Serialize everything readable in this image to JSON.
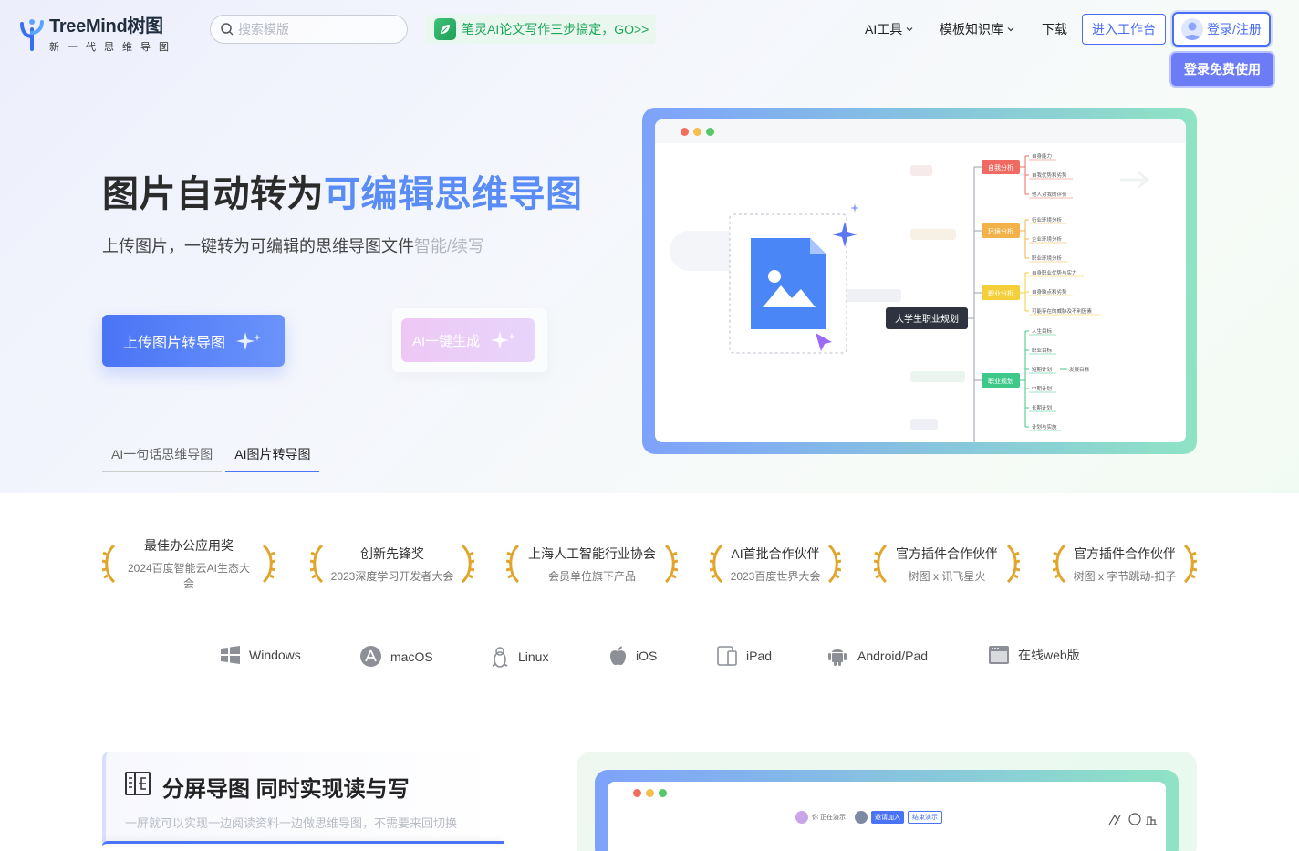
{
  "header": {
    "logo_name": "TreeMind树图",
    "logo_slogan": "新一代思维导图",
    "search_placeholder": "搜索模版",
    "promo_text": "笔灵AI论文写作三步搞定，GO>>",
    "nav": [
      {
        "label": "AI工具",
        "has_dropdown": true
      },
      {
        "label": "模板知识库",
        "has_dropdown": true
      },
      {
        "label": "下载",
        "has_dropdown": false
      }
    ],
    "workspace_label": "进入工作台",
    "login_label": "登录/注册",
    "free_label": "登录免费使用"
  },
  "hero": {
    "title_main": "图片自动转为",
    "title_highlight": "可编辑思维导图",
    "subtitle": "上传图片，一键转为可编辑的思维导图文件",
    "subtitle_fade": "智能/续写",
    "upload_label": "上传图片转导图",
    "ai_label": "AI一键生成",
    "tabs": [
      {
        "label": "AI一句话思维导图",
        "active": false
      },
      {
        "label": "AI图片转导图",
        "active": true
      }
    ]
  },
  "preview": {
    "root": "大学生职业规划",
    "branches": [
      {
        "label": "自我分析",
        "color": "#ef6b62",
        "children": [
          "自身能力",
          "自我优势和劣势",
          "他人对我的评价"
        ]
      },
      {
        "label": "环境分析",
        "color": "#f3b14a",
        "children": [
          "行业环境分析",
          "企业环境分析",
          "职业环境分析"
        ]
      },
      {
        "label": "职业分析",
        "color": "#f5cf3a",
        "children": [
          "自身职业优势与实力",
          "自身缺点和劣势",
          "可能存在的威胁及不利因素"
        ]
      },
      {
        "label": "职业规划",
        "color": "#3ec98a",
        "children": [
          "人生目标",
          "职业目标",
          "短期计划",
          "中期计划",
          "长期计划",
          "计划与实施"
        ]
      }
    ],
    "extra_child": "发展目标"
  },
  "awards": [
    {
      "title": "最佳办公应用奖",
      "sub": "2024百度智能云AI生态大会"
    },
    {
      "title": "创新先锋奖",
      "sub": "2023深度学习开发者大会"
    },
    {
      "title": "上海人工智能行业协会",
      "sub": "会员单位旗下产品"
    },
    {
      "title": "AI首批合作伙伴",
      "sub": "2023百度世界大会"
    },
    {
      "title": "官方插件合作伙伴",
      "sub": "树图 x 讯飞星火"
    },
    {
      "title": "官方插件合作伙伴",
      "sub": "树图 x 字节跳动-扣子"
    }
  ],
  "platforms": [
    {
      "label": "Windows",
      "icon": "windows-icon"
    },
    {
      "label": "macOS",
      "icon": "appstore-icon"
    },
    {
      "label": "Linux",
      "icon": "linux-icon"
    },
    {
      "label": "iOS",
      "icon": "apple-icon"
    },
    {
      "label": "iPad",
      "icon": "ipad-icon"
    },
    {
      "label": "Android/Pad",
      "icon": "android-icon"
    },
    {
      "label": "在线web版",
      "icon": "web-icon"
    }
  ],
  "feature": {
    "title": "分屏导图 同时实现读与写",
    "subtitle": "一屏就可以实现一边阅读资料一边做思维导图，不需要来回切换"
  },
  "preview2": {
    "presenting": "你 正在演示",
    "invite": "邀请加入",
    "end": "结束演示"
  },
  "colors": {
    "accent": "#4a74f5",
    "green": "#1aa557"
  }
}
